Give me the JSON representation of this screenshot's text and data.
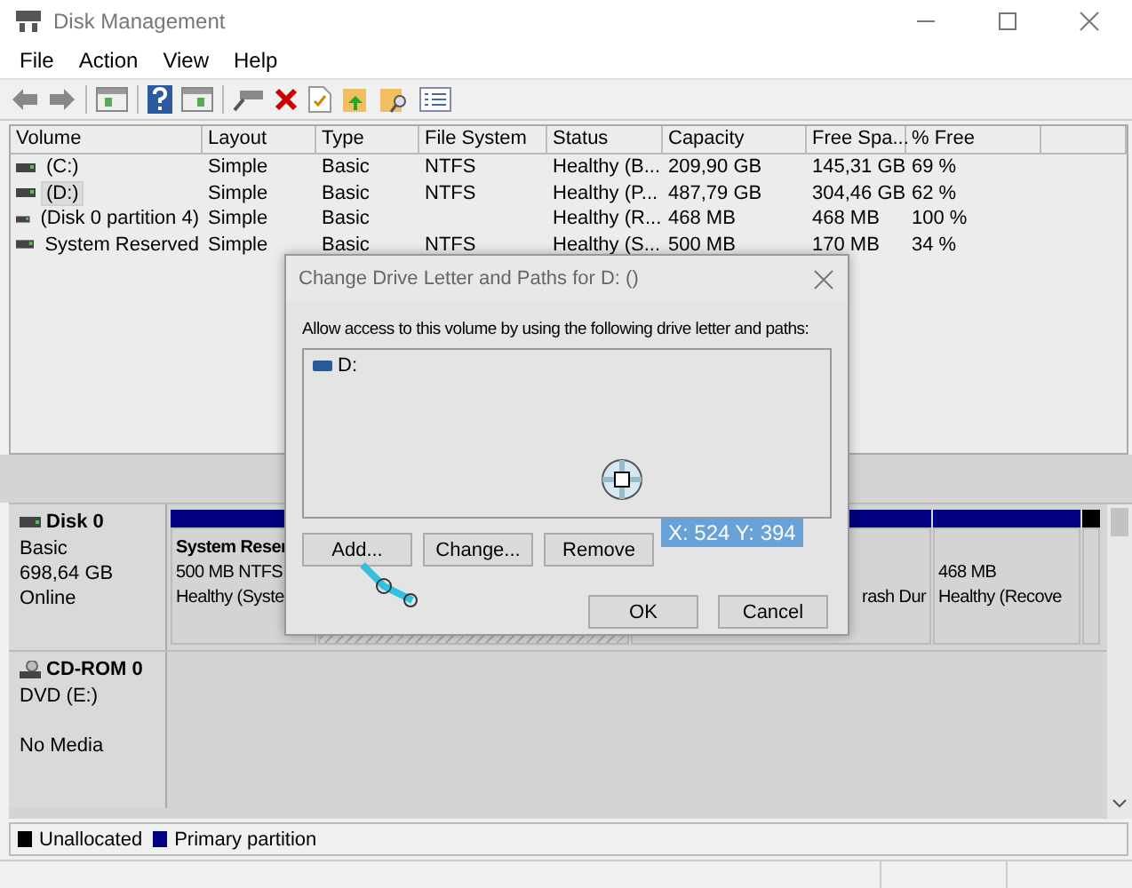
{
  "window": {
    "title": "Disk Management"
  },
  "menu": [
    "File",
    "Action",
    "View",
    "Help"
  ],
  "volume_table": {
    "columns": [
      "Volume",
      "Layout",
      "Type",
      "File System",
      "Status",
      "Capacity",
      "Free Spa...",
      "% Free"
    ],
    "rows": [
      {
        "selected": false,
        "cells": [
          "(C:)",
          "Simple",
          "Basic",
          "NTFS",
          "Healthy (B...",
          "209,90 GB",
          "145,31 GB",
          "69 %"
        ]
      },
      {
        "selected": true,
        "cells": [
          "(D:)",
          "Simple",
          "Basic",
          "NTFS",
          "Healthy (P...",
          "487,79 GB",
          "304,46 GB",
          "62 %"
        ]
      },
      {
        "selected": false,
        "cells": [
          "(Disk 0 partition 4)",
          "Simple",
          "Basic",
          "",
          "Healthy (R...",
          "468 MB",
          "468 MB",
          "100 %"
        ]
      },
      {
        "selected": false,
        "cells": [
          "System Reserved",
          "Simple",
          "Basic",
          "NTFS",
          "Healthy (S...",
          "500 MB",
          "170 MB",
          "34 %"
        ]
      }
    ]
  },
  "disks": [
    {
      "kind": "disk",
      "name": "Disk 0",
      "lines": [
        "Basic",
        "698,64 GB",
        "Online"
      ],
      "partitions": [
        {
          "kind": "primary",
          "selected": false,
          "title": "System Reser",
          "lines": [
            "500 MB NTFS",
            "Healthy (Syste"
          ]
        },
        {
          "kind": "primary",
          "selected": true
        },
        {
          "kind": "primary",
          "selected": false,
          "lines": [
            "rash Dur"
          ]
        },
        {
          "kind": "primary",
          "selected": false,
          "lines": [
            "468 MB",
            "Healthy (Recove"
          ]
        },
        {
          "kind": "unallocated",
          "selected": false
        }
      ]
    },
    {
      "kind": "cdrom",
      "name": "CD-ROM 0",
      "lines": [
        "DVD (E:)",
        "No Media"
      ]
    }
  ],
  "legend": [
    {
      "kind": "unallocated",
      "label": "Unallocated",
      "color": "#000000"
    },
    {
      "kind": "primary",
      "label": "Primary partition",
      "color": "#000080"
    }
  ],
  "dialog": {
    "title": "Change Drive Letter and Paths for D: ()",
    "prompt": "Allow access to this volume by using the following drive letter and paths:",
    "items": [
      {
        "label": "D:",
        "selected": false
      }
    ],
    "buttons": [
      "Add...",
      "Change...",
      "Remove"
    ],
    "footer_buttons": [
      "OK",
      "Cancel"
    ]
  },
  "overlay": {
    "coordinates": "X: 524 Y: 394"
  }
}
